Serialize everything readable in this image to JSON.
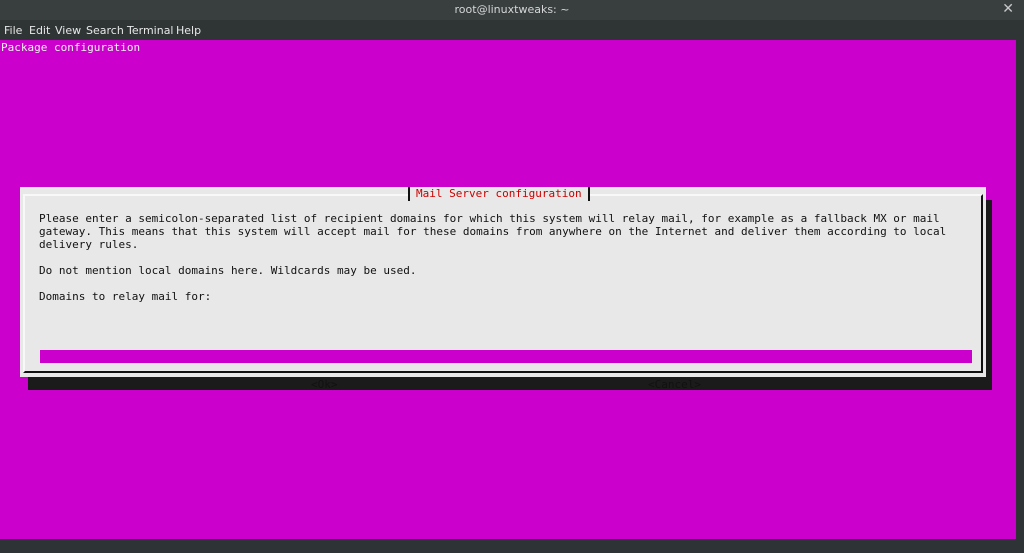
{
  "window": {
    "title": "root@linuxtweaks: ~",
    "close_glyph": "✕"
  },
  "menu": {
    "items": [
      "File",
      "Edit",
      "View",
      "Search",
      "Terminal",
      "Help"
    ]
  },
  "terminal": {
    "header": "Package configuration",
    "dialog": {
      "title": "Mail Server configuration",
      "paragraph1": "Please enter a semicolon-separated list of recipient domains for which this system will relay mail, for example as a fallback MX or mail\ngateway. This means that this system will accept mail for these domains from anywhere on the Internet and deliver them according to local\ndelivery rules.",
      "paragraph2": "Do not mention local domains here. Wildcards may be used.",
      "prompt": "Domains to relay mail for:",
      "input_value": "",
      "ok_label": "<Ok>",
      "cancel_label": "<Cancel>"
    },
    "colors": {
      "background": "#cc00cc",
      "dialog": "#e8e8e8",
      "title": "#cc0000"
    }
  }
}
